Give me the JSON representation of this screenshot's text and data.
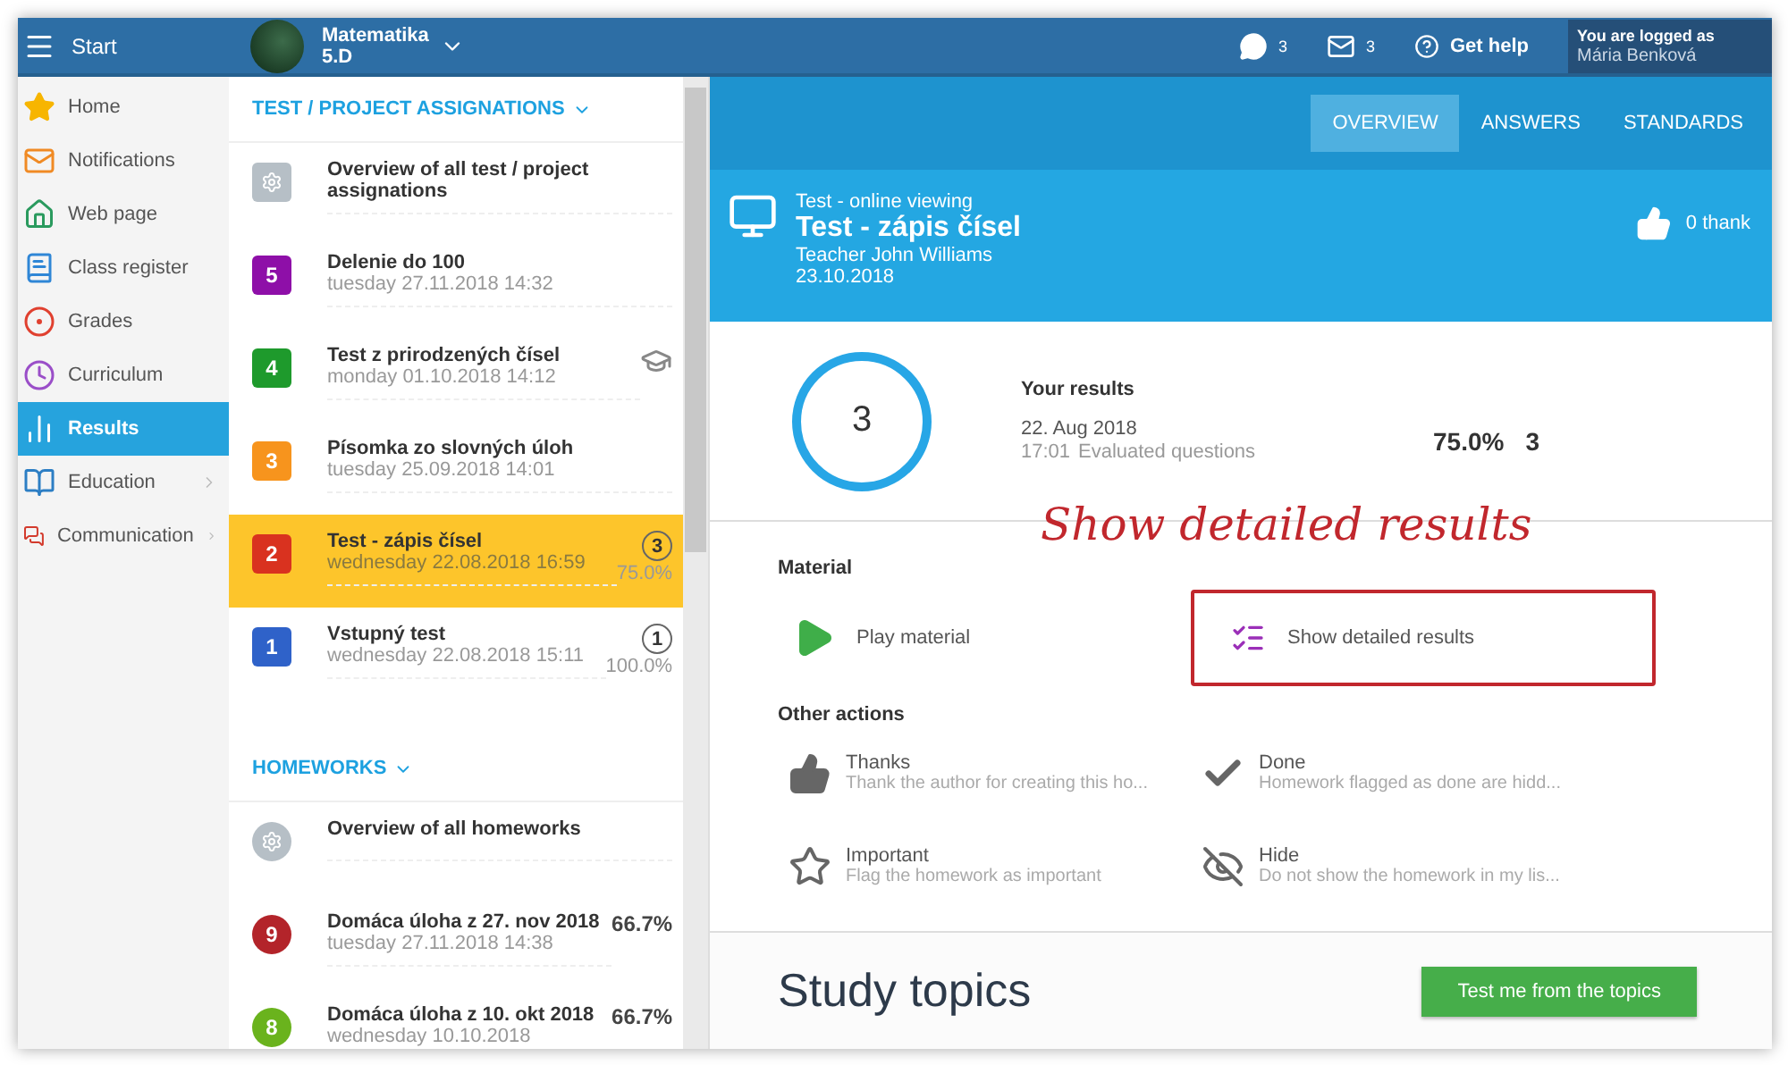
{
  "topbar": {
    "menu_label": "Start",
    "class_name": "Matematika",
    "class_sub": "5.D",
    "messages_count": "3",
    "mail_count": "3",
    "help": "Get help",
    "logged_label": "You are logged as",
    "user": "Mária Benková"
  },
  "sidebar": {
    "items": [
      {
        "label": "Home",
        "selected": false,
        "expandable": false
      },
      {
        "label": "Notifications",
        "selected": false,
        "expandable": false
      },
      {
        "label": "Web page",
        "selected": false,
        "expandable": false
      },
      {
        "label": "Class register",
        "selected": false,
        "expandable": false
      },
      {
        "label": "Grades",
        "selected": false,
        "expandable": false
      },
      {
        "label": "Curriculum",
        "selected": false,
        "expandable": false
      },
      {
        "label": "Results",
        "selected": true,
        "expandable": false
      },
      {
        "label": "Education",
        "selected": false,
        "expandable": true
      },
      {
        "label": "Communication",
        "selected": false,
        "expandable": true
      }
    ]
  },
  "sections": [
    {
      "title": "TEST / PROJECT ASSIGNATIONS",
      "round_badges": false,
      "items": [
        {
          "kind": "overview",
          "title": "Overview of all test / project assignations",
          "selected": false
        },
        {
          "kind": "entry",
          "badge": "5",
          "color": "#8e0fa8",
          "title": "Delenie do 100",
          "date": "tuesday 27.11.2018 14:32",
          "selected": false
        },
        {
          "kind": "entry",
          "badge": "4",
          "color": "#1e9a2c",
          "title": "Test z prirodzených čísel",
          "date": "monday 01.10.2018 14:12",
          "selected": false,
          "graded": true
        },
        {
          "kind": "entry",
          "badge": "3",
          "color": "#f7941d",
          "title": "Písomka zo slovných úloh",
          "date": "tuesday 25.09.2018 14:01",
          "selected": false
        },
        {
          "kind": "entry",
          "badge": "2",
          "color": "#d9321f",
          "title": "Test - zápis čísel",
          "date": "wednesday 22.08.2018 16:59",
          "score": "3",
          "percent": "75.0%",
          "selected": true
        },
        {
          "kind": "entry",
          "badge": "1",
          "color": "#2f62c9",
          "title": "Vstupný test",
          "date": "wednesday 22.08.2018 15:11",
          "score": "1",
          "percent": "100.0%",
          "selected": false
        }
      ]
    },
    {
      "title": "HOMEWORKS",
      "round_badges": true,
      "items": [
        {
          "kind": "overview",
          "title": "Overview of all homeworks",
          "selected": false
        },
        {
          "kind": "entry",
          "badge": "9",
          "color": "#b3242a",
          "title": "Domáca úloha z 27. nov 2018",
          "date": "tuesday 27.11.2018 14:38",
          "percent": "66.7%",
          "selected": false
        },
        {
          "kind": "entry",
          "badge": "8",
          "color": "#6ab31d",
          "title": "Domáca úloha z 10. okt 2018",
          "date": "wednesday 10.10.2018",
          "percent": "66.7%",
          "selected": false
        }
      ]
    }
  ],
  "tabs": [
    {
      "label": "OVERVIEW",
      "selected": true
    },
    {
      "label": "ANSWERS",
      "selected": false
    },
    {
      "label": "STANDARDS",
      "selected": false
    }
  ],
  "header": {
    "kind_label": "Test - online viewing",
    "title": "Test - zápis čísel",
    "teacher": "Teacher John Williams",
    "date": "23.10.2018",
    "thanks": "0 thank"
  },
  "results": {
    "score": "3",
    "title": "Your results",
    "date": "22. Aug 2018",
    "time": "17:01",
    "note": "Evaluated questions",
    "percent": "75.0%",
    "points": "3"
  },
  "annotation": "Show detailed results",
  "material": {
    "title": "Material",
    "items": [
      {
        "label": "Play material",
        "highlighted": false
      },
      {
        "label": "Show detailed results",
        "highlighted": true
      }
    ]
  },
  "other_actions": {
    "title": "Other actions",
    "items": [
      {
        "title": "Thanks",
        "description": "Thank the author for creating this ho..."
      },
      {
        "title": "Done",
        "description": "Homework flagged as done are hidd..."
      },
      {
        "title": "Important",
        "description": "Flag the homework as important"
      },
      {
        "title": "Hide",
        "description": "Do not show the homework in my lis..."
      }
    ]
  },
  "study_topics": {
    "title": "Study topics",
    "button": "Test me from the topics"
  }
}
